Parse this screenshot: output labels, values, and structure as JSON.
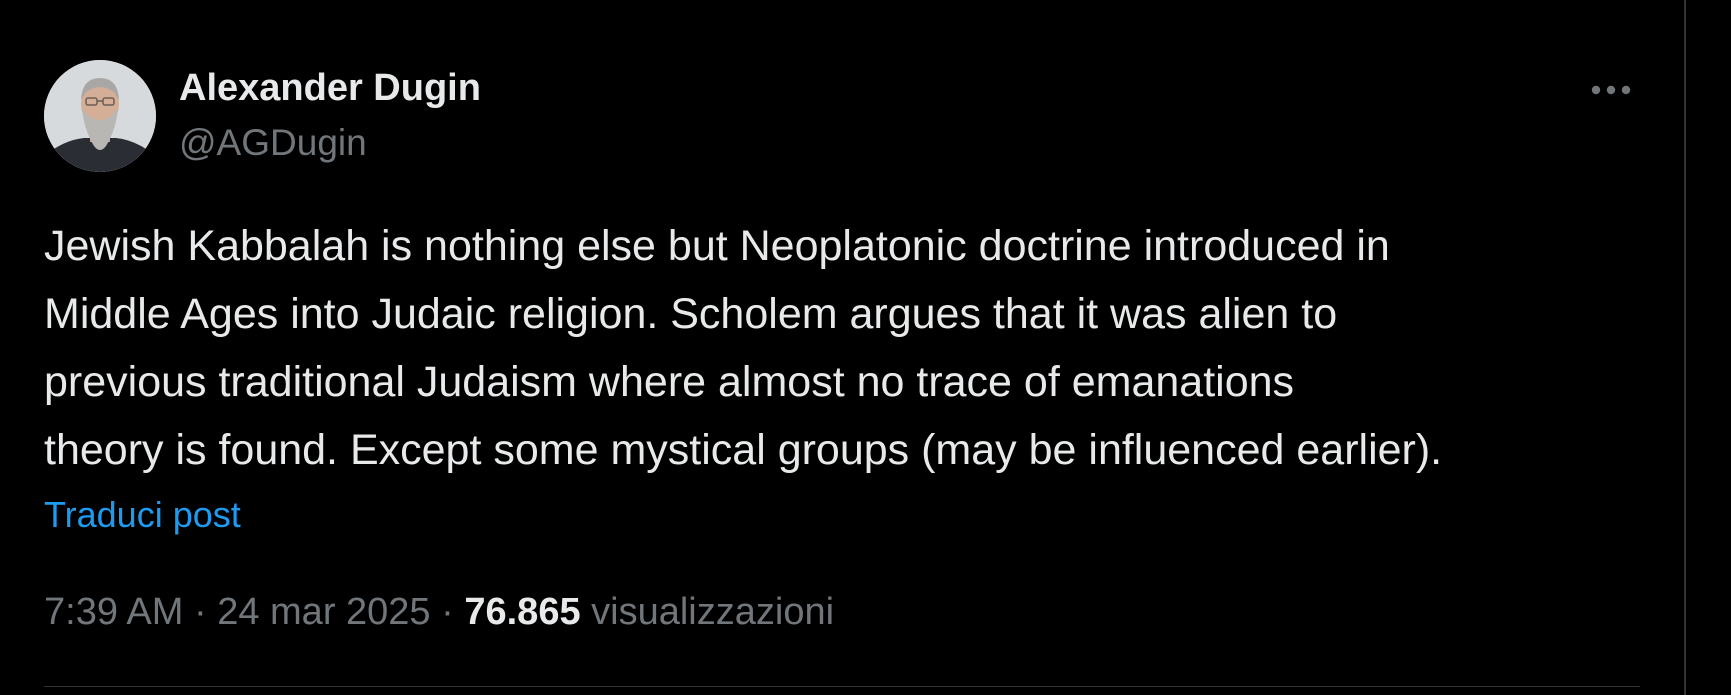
{
  "tweet": {
    "author": {
      "display_name": "Alexander Dugin",
      "handle": "@AGDugin",
      "avatar_icon": "user-avatar-photo"
    },
    "more_icon": "more-horizontal-icon",
    "text": "Jewish Kabbalah is nothing else but Neoplatonic doctrine introduced in\nMiddle Ages into Judaic religion. Scholem argues that it was alien to\nprevious traditional Judaism where almost no trace of emanations\ntheory is found. Except some mystical groups (may be influenced earlier).",
    "translate_label": "Traduci post",
    "time": "7:39 AM",
    "separator": "·",
    "date": "24 mar 2025",
    "views_count": "76.865",
    "views_label": "visualizzazioni"
  },
  "colors": {
    "background": "#000000",
    "text_primary": "#e7e9ea",
    "text_secondary": "#71767b",
    "link": "#1d9bf0",
    "border": "#2f3336"
  }
}
